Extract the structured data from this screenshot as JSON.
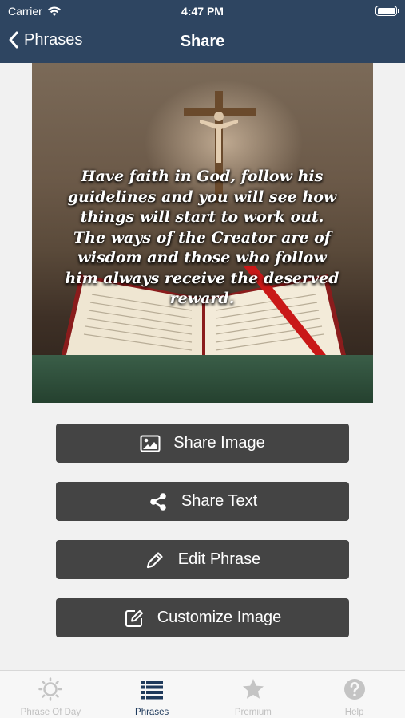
{
  "status_bar": {
    "carrier": "Carrier",
    "time": "4:47 PM"
  },
  "nav": {
    "back_label": "Phrases",
    "title": "Share"
  },
  "image": {
    "quote": "Have faith in God, follow his guidelines and you will see how things will start to work out. The ways of the Creator are of wisdom and those who follow him always receive the deserved reward."
  },
  "actions": [
    {
      "label": "Share Image",
      "icon": "image-icon"
    },
    {
      "label": "Share Text",
      "icon": "share-icon"
    },
    {
      "label": "Edit Phrase",
      "icon": "pencil-icon"
    },
    {
      "label": "Customize Image",
      "icon": "edit-square-icon"
    }
  ],
  "tabs": [
    {
      "label": "Phrase Of Day",
      "icon": "sun-icon",
      "active": false
    },
    {
      "label": "Phrases",
      "icon": "list-icon",
      "active": true
    },
    {
      "label": "Premium",
      "icon": "star-icon",
      "active": false
    },
    {
      "label": "Help",
      "icon": "help-icon",
      "active": false
    }
  ],
  "colors": {
    "header": "#2e4561",
    "button": "#444444",
    "tab_active": "#1f3a5c",
    "tab_inactive": "#c0c0c0"
  }
}
